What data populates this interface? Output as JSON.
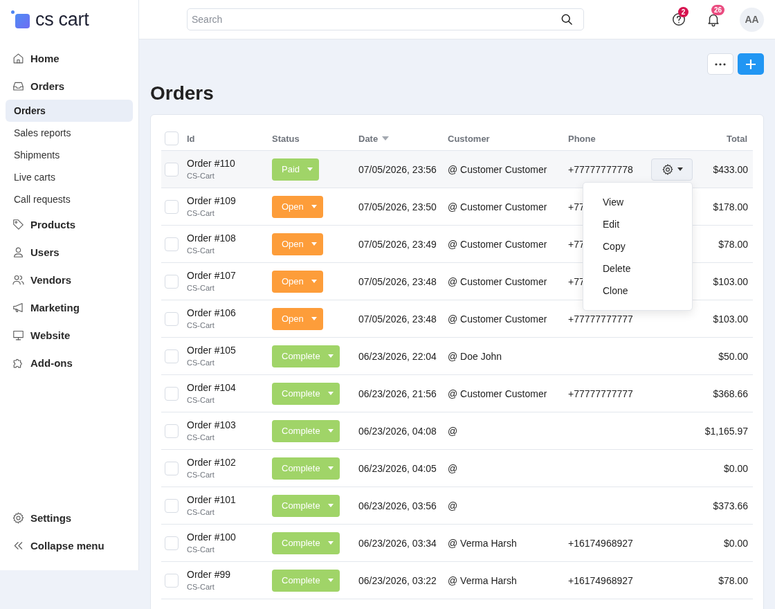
{
  "sidebar": {
    "logo": {
      "text": "cs cart"
    },
    "items": [
      {
        "label": "Home",
        "selected": false
      },
      {
        "label": "Orders",
        "selected": false,
        "children": [
          {
            "label": "Orders",
            "selected": true
          },
          {
            "label": "Sales reports",
            "selected": false
          },
          {
            "label": "Shipments",
            "selected": false
          },
          {
            "label": "Live carts",
            "selected": false
          },
          {
            "label": "Call requests",
            "selected": false
          }
        ]
      },
      {
        "label": "Products",
        "selected": false
      },
      {
        "label": "Users",
        "selected": false
      },
      {
        "label": "Vendors",
        "selected": false
      },
      {
        "label": "Marketing",
        "selected": false
      },
      {
        "label": "Website",
        "selected": false
      },
      {
        "label": "Add-ons",
        "selected": false
      }
    ],
    "footer_items": [
      {
        "label": "Settings"
      },
      {
        "label": "Collapse menu"
      }
    ]
  },
  "top_bar": {
    "search": {
      "placeholder": "Search"
    },
    "help": {
      "badge": "2",
      "color": "#d6134f"
    },
    "notifications": {
      "badge": "26",
      "color": "#ea4c80"
    },
    "avatar": {
      "initials": "AA"
    }
  },
  "page": {
    "title": "Orders"
  },
  "table": {
    "select_all": {
      "checked": false
    },
    "columns": [
      {
        "label": "Id",
        "sorted": false
      },
      {
        "label": "Status",
        "sorted": false
      },
      {
        "label": "Date",
        "sorted": true
      },
      {
        "label": "Customer",
        "sorted": false
      },
      {
        "label": "Phone",
        "sorted": false
      },
      {
        "label": "Total",
        "sorted": false
      }
    ],
    "row_menu": {
      "items": [
        "View",
        "Edit",
        "Copy",
        "Delete",
        "Clone"
      ]
    },
    "rows": [
      {
        "checked": false,
        "menu_open": true,
        "id": "Order #110",
        "store": "CS-Cart",
        "status": {
          "label": "Paid",
          "color": "#a0d468"
        },
        "date": "07/05/2026, 23:56",
        "customer": "@ Customer Customer",
        "phone": "+77777777778",
        "total": "$433.00"
      },
      {
        "checked": false,
        "menu_open": false,
        "id": "Order #109",
        "store": "CS-Cart",
        "status": {
          "label": "Open",
          "color": "#fd9d3a"
        },
        "date": "07/05/2026, 23:50",
        "customer": "@ Customer Customer",
        "phone": "+77",
        "total": "$178.00"
      },
      {
        "checked": false,
        "menu_open": false,
        "id": "Order #108",
        "store": "CS-Cart",
        "status": {
          "label": "Open",
          "color": "#fd9d3a"
        },
        "date": "07/05/2026, 23:49",
        "customer": "@ Customer Customer",
        "phone": "+77",
        "total": "$78.00"
      },
      {
        "checked": false,
        "menu_open": false,
        "id": "Order #107",
        "store": "CS-Cart",
        "status": {
          "label": "Open",
          "color": "#fd9d3a"
        },
        "date": "07/05/2026, 23:48",
        "customer": "@ Customer Customer",
        "phone": "+77",
        "total": "$103.00"
      },
      {
        "checked": false,
        "menu_open": false,
        "id": "Order #106",
        "store": "CS-Cart",
        "status": {
          "label": "Open",
          "color": "#fd9d3a"
        },
        "date": "07/05/2026, 23:48",
        "customer": "@ Customer Customer",
        "phone": "+77777777777",
        "total": "$103.00"
      },
      {
        "checked": false,
        "menu_open": false,
        "id": "Order #105",
        "store": "CS-Cart",
        "status": {
          "label": "Complete",
          "color": "#a0d468"
        },
        "date": "06/23/2026, 22:04",
        "customer": "@ Doe John",
        "total": "$50.00"
      },
      {
        "checked": false,
        "menu_open": false,
        "id": "Order #104",
        "store": "CS-Cart",
        "status": {
          "label": "Complete",
          "color": "#a0d468"
        },
        "date": "06/23/2026, 21:56",
        "customer": "@ Customer Customer",
        "phone": "+77777777777",
        "total": "$368.66"
      },
      {
        "checked": false,
        "menu_open": false,
        "id": "Order #103",
        "store": "CS-Cart",
        "status": {
          "label": "Complete",
          "color": "#a0d468"
        },
        "date": "06/23/2026, 04:08",
        "customer": "@",
        "total": "$1,165.97"
      },
      {
        "checked": false,
        "menu_open": false,
        "id": "Order #102",
        "store": "CS-Cart",
        "status": {
          "label": "Complete",
          "color": "#a0d468"
        },
        "date": "06/23/2026, 04:05",
        "customer": "@",
        "total": "$0.00"
      },
      {
        "checked": false,
        "menu_open": false,
        "id": "Order #101",
        "store": "CS-Cart",
        "status": {
          "label": "Complete",
          "color": "#a0d468"
        },
        "date": "06/23/2026, 03:56",
        "customer": "@",
        "total": "$373.66"
      },
      {
        "checked": false,
        "menu_open": false,
        "id": "Order #100",
        "store": "CS-Cart",
        "status": {
          "label": "Complete",
          "color": "#a0d468"
        },
        "date": "06/23/2026, 03:34",
        "customer": "@ Verma Harsh",
        "phone": "+16174968927",
        "total": "$0.00"
      },
      {
        "checked": false,
        "menu_open": false,
        "id": "Order #99",
        "store": "CS-Cart",
        "status": {
          "label": "Complete",
          "color": "#a0d468"
        },
        "date": "06/23/2026, 03:22",
        "customer": "@ Verma Harsh",
        "phone": "+16174968927",
        "total": "$78.00"
      }
    ]
  }
}
